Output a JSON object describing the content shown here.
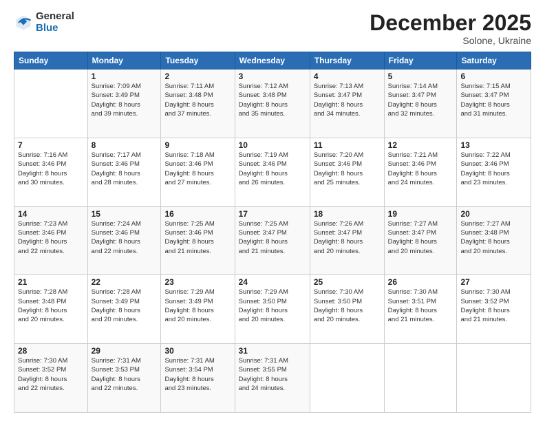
{
  "logo": {
    "general": "General",
    "blue": "Blue"
  },
  "header": {
    "month": "December 2025",
    "location": "Solone, Ukraine"
  },
  "weekdays": [
    "Sunday",
    "Monday",
    "Tuesday",
    "Wednesday",
    "Thursday",
    "Friday",
    "Saturday"
  ],
  "weeks": [
    [
      {
        "day": "",
        "info": ""
      },
      {
        "day": "1",
        "info": "Sunrise: 7:09 AM\nSunset: 3:49 PM\nDaylight: 8 hours\nand 39 minutes."
      },
      {
        "day": "2",
        "info": "Sunrise: 7:11 AM\nSunset: 3:48 PM\nDaylight: 8 hours\nand 37 minutes."
      },
      {
        "day": "3",
        "info": "Sunrise: 7:12 AM\nSunset: 3:48 PM\nDaylight: 8 hours\nand 35 minutes."
      },
      {
        "day": "4",
        "info": "Sunrise: 7:13 AM\nSunset: 3:47 PM\nDaylight: 8 hours\nand 34 minutes."
      },
      {
        "day": "5",
        "info": "Sunrise: 7:14 AM\nSunset: 3:47 PM\nDaylight: 8 hours\nand 32 minutes."
      },
      {
        "day": "6",
        "info": "Sunrise: 7:15 AM\nSunset: 3:47 PM\nDaylight: 8 hours\nand 31 minutes."
      }
    ],
    [
      {
        "day": "7",
        "info": "Sunrise: 7:16 AM\nSunset: 3:46 PM\nDaylight: 8 hours\nand 30 minutes."
      },
      {
        "day": "8",
        "info": "Sunrise: 7:17 AM\nSunset: 3:46 PM\nDaylight: 8 hours\nand 28 minutes."
      },
      {
        "day": "9",
        "info": "Sunrise: 7:18 AM\nSunset: 3:46 PM\nDaylight: 8 hours\nand 27 minutes."
      },
      {
        "day": "10",
        "info": "Sunrise: 7:19 AM\nSunset: 3:46 PM\nDaylight: 8 hours\nand 26 minutes."
      },
      {
        "day": "11",
        "info": "Sunrise: 7:20 AM\nSunset: 3:46 PM\nDaylight: 8 hours\nand 25 minutes."
      },
      {
        "day": "12",
        "info": "Sunrise: 7:21 AM\nSunset: 3:46 PM\nDaylight: 8 hours\nand 24 minutes."
      },
      {
        "day": "13",
        "info": "Sunrise: 7:22 AM\nSunset: 3:46 PM\nDaylight: 8 hours\nand 23 minutes."
      }
    ],
    [
      {
        "day": "14",
        "info": "Sunrise: 7:23 AM\nSunset: 3:46 PM\nDaylight: 8 hours\nand 22 minutes."
      },
      {
        "day": "15",
        "info": "Sunrise: 7:24 AM\nSunset: 3:46 PM\nDaylight: 8 hours\nand 22 minutes."
      },
      {
        "day": "16",
        "info": "Sunrise: 7:25 AM\nSunset: 3:46 PM\nDaylight: 8 hours\nand 21 minutes."
      },
      {
        "day": "17",
        "info": "Sunrise: 7:25 AM\nSunset: 3:47 PM\nDaylight: 8 hours\nand 21 minutes."
      },
      {
        "day": "18",
        "info": "Sunrise: 7:26 AM\nSunset: 3:47 PM\nDaylight: 8 hours\nand 20 minutes."
      },
      {
        "day": "19",
        "info": "Sunrise: 7:27 AM\nSunset: 3:47 PM\nDaylight: 8 hours\nand 20 minutes."
      },
      {
        "day": "20",
        "info": "Sunrise: 7:27 AM\nSunset: 3:48 PM\nDaylight: 8 hours\nand 20 minutes."
      }
    ],
    [
      {
        "day": "21",
        "info": "Sunrise: 7:28 AM\nSunset: 3:48 PM\nDaylight: 8 hours\nand 20 minutes."
      },
      {
        "day": "22",
        "info": "Sunrise: 7:28 AM\nSunset: 3:49 PM\nDaylight: 8 hours\nand 20 minutes."
      },
      {
        "day": "23",
        "info": "Sunrise: 7:29 AM\nSunset: 3:49 PM\nDaylight: 8 hours\nand 20 minutes."
      },
      {
        "day": "24",
        "info": "Sunrise: 7:29 AM\nSunset: 3:50 PM\nDaylight: 8 hours\nand 20 minutes."
      },
      {
        "day": "25",
        "info": "Sunrise: 7:30 AM\nSunset: 3:50 PM\nDaylight: 8 hours\nand 20 minutes."
      },
      {
        "day": "26",
        "info": "Sunrise: 7:30 AM\nSunset: 3:51 PM\nDaylight: 8 hours\nand 21 minutes."
      },
      {
        "day": "27",
        "info": "Sunrise: 7:30 AM\nSunset: 3:52 PM\nDaylight: 8 hours\nand 21 minutes."
      }
    ],
    [
      {
        "day": "28",
        "info": "Sunrise: 7:30 AM\nSunset: 3:52 PM\nDaylight: 8 hours\nand 22 minutes."
      },
      {
        "day": "29",
        "info": "Sunrise: 7:31 AM\nSunset: 3:53 PM\nDaylight: 8 hours\nand 22 minutes."
      },
      {
        "day": "30",
        "info": "Sunrise: 7:31 AM\nSunset: 3:54 PM\nDaylight: 8 hours\nand 23 minutes."
      },
      {
        "day": "31",
        "info": "Sunrise: 7:31 AM\nSunset: 3:55 PM\nDaylight: 8 hours\nand 24 minutes."
      },
      {
        "day": "",
        "info": ""
      },
      {
        "day": "",
        "info": ""
      },
      {
        "day": "",
        "info": ""
      }
    ]
  ]
}
